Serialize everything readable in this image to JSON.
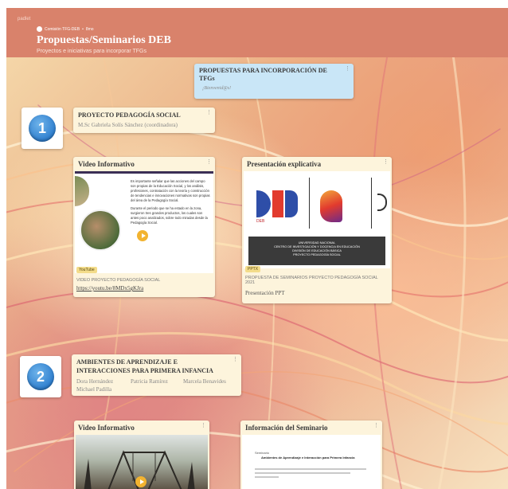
{
  "app": {
    "label": "padlet"
  },
  "header": {
    "breadcrumb_user": "Comisión TFG-DEB",
    "breadcrumb_sep": "•",
    "breadcrumb_time": "8mo",
    "title": "Propuestas/Seminarios DEB",
    "subtitle": "Proyectos e iniciativas para incorporar TFGs"
  },
  "welcome": {
    "title": "PROPUESTAS PARA INCORPORACIÓN DE TFGs",
    "text": "¡Bienvenid@s!"
  },
  "section1": {
    "number": "1",
    "title": "PROYECTO PEDAGOGÍA SOCIAL",
    "author": "M.Sc Gabriela Solís Sánchez (coordinadora)"
  },
  "video1": {
    "title": "Video Informativo",
    "badge": "YouTube",
    "bullet1": "Es importante señalar que las acciones del campo son propias de la Educación Social, y los análisis, profesiones, contratación con la teoría y construcción de tendencias e innovaciones normativas son propias del área de la Pedagogía Social.",
    "bullet2": "Durante el periodo que se ha estado en la zona, surgieron tres grandes productos, los cuales son antes poco analizados, sobre todo miradas desde la Pedagogía Social.",
    "meta": "VIDEO PROYECTO PEDAGOGÍA SOCIAL",
    "link": "https://youtu.be/8MDx5gKJra"
  },
  "presentation1": {
    "title": "Presentación explicativa",
    "badge": "PPTX",
    "slide_line1": "UNIVERSIDAD NACIONAL",
    "slide_line2": "CENTRO DE INVESTIGACIÓN Y DOCENCIA EN EDUCACIÓN",
    "slide_line3": "DIVISIÓN DE EDUCACIÓN BÁSICA",
    "slide_line4": "PROYECTO PEDAGOGÍA SOCIAL",
    "logo_text": "DEB",
    "meta": "PROPUESTA DE SEMINARIOS PROYECTO PEDAGOGÍA SOCIAL 2021",
    "caption": "Presentación PPT"
  },
  "section2": {
    "number": "2",
    "title_line1": "AMBIENTES DE APRENDIZAJE E",
    "title_line2": "INTERACCIONES PARA PRIMERA INFANCIA",
    "person1": "Dora Hernández",
    "person2": "Patricia Ramírez",
    "person3": "Marcela Benavides",
    "person4": "Michael Padilla"
  },
  "video2": {
    "title": "Video Informativo"
  },
  "seminar2": {
    "title": "Información del Seminario",
    "doc_label": "Seminario",
    "doc_title": "Ambientes de Aprendizaje e Interacción para Primera Infancia"
  },
  "colors": {
    "header": "#d9826b",
    "card": "#fdf4dc",
    "welcome": "#c9e6f7",
    "number": "#2f7fcf"
  }
}
